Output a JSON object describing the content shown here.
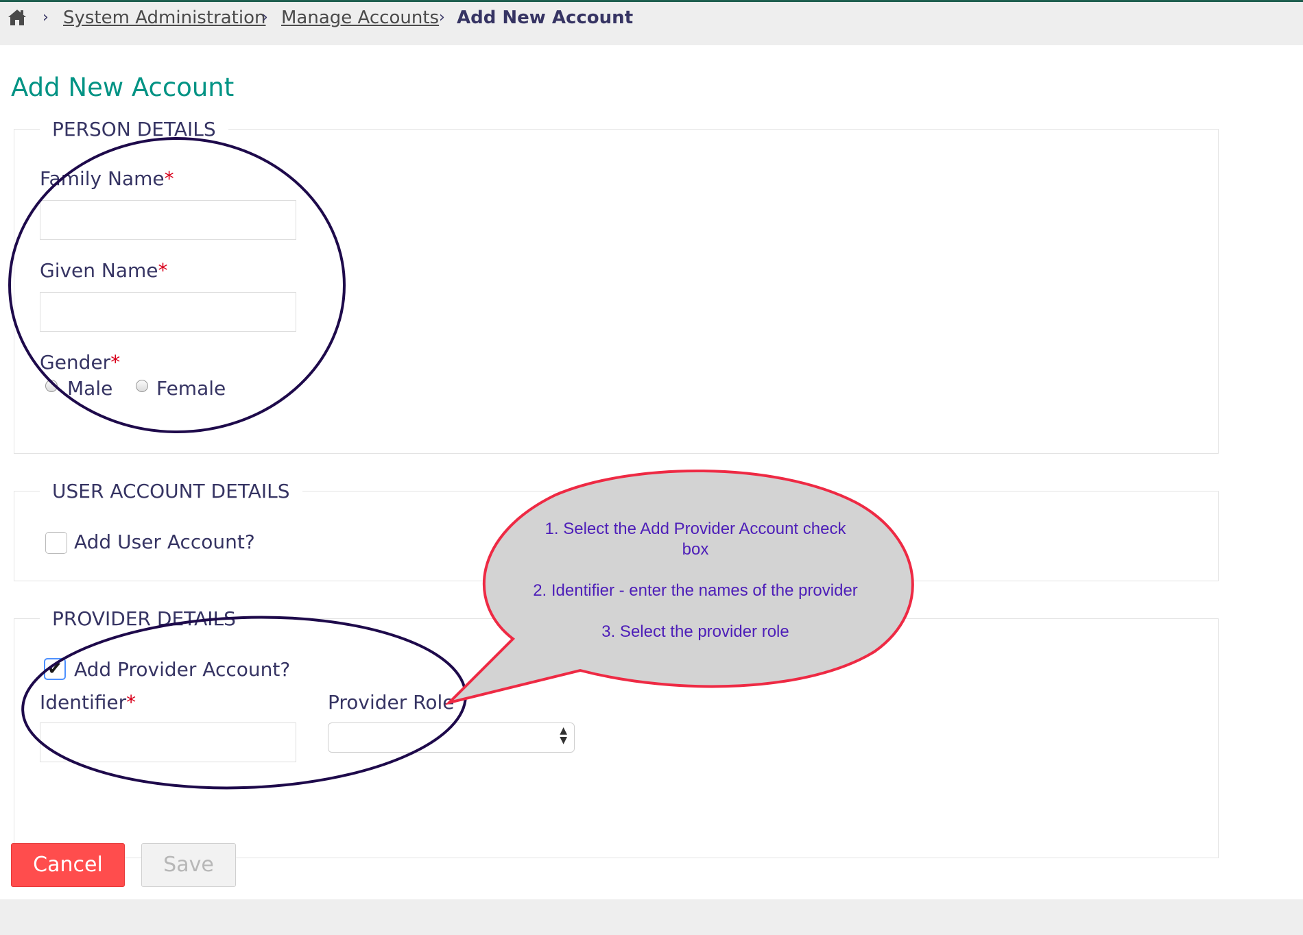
{
  "breadcrumb": {
    "home_icon": "home-icon",
    "items": [
      "System Administration ",
      "Manage Accounts ",
      "Add New Account"
    ],
    "separator": "›"
  },
  "page": {
    "title": "Add New Account"
  },
  "person_details": {
    "legend": "PERSON DETAILS",
    "family_name_label": "Family Name",
    "given_name_label": "Given Name",
    "gender_label": "Gender",
    "required_mark": "*",
    "gender_options": [
      "Male",
      "Female"
    ],
    "family_name_value": "",
    "given_name_value": ""
  },
  "user_account": {
    "legend": "USER ACCOUNT DETAILS",
    "checkbox_label": "Add User Account?",
    "checked": false
  },
  "provider_details": {
    "legend": "PROVIDER DETAILS",
    "checkbox_label": "Add Provider Account?",
    "checked": true,
    "check_mark": "✔",
    "identifier_label": "Identifier",
    "provider_role_label": "Provider Role",
    "identifier_value": "",
    "provider_role_value": ""
  },
  "buttons": {
    "cancel": "Cancel",
    "save": "Save"
  },
  "annotation": {
    "step1_line1": "1. Select the Add Provider Account check",
    "step1_line2": "box",
    "step2": "2. Identifier - enter the names of the provider",
    "step3": "3. Select the provider role"
  },
  "colors": {
    "title_teal": "#009384",
    "text_navy": "#363463",
    "required_red": "#d9001b",
    "cancel_red": "#ff4d4d",
    "ellipse_stroke": "#1e0a4b",
    "callout_stroke": "#ee2a44",
    "callout_fill": "#d3d3d3",
    "callout_text": "#4d1eb8"
  }
}
